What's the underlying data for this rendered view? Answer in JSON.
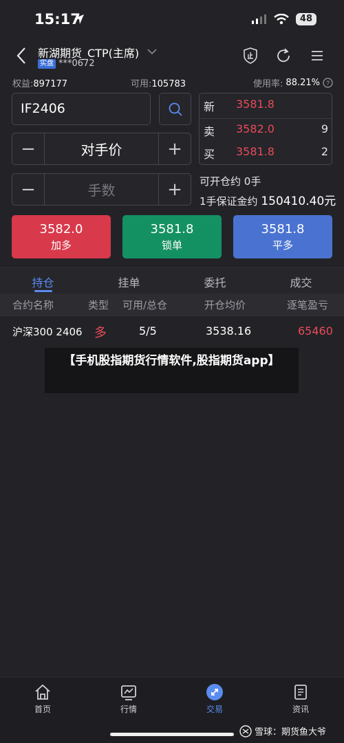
{
  "status_bar": {
    "time": "15:17",
    "battery": "48"
  },
  "header": {
    "account_name": "新湖期货_CTP(主席)",
    "account_tag": "实盘",
    "account_id": "***0672"
  },
  "account_info": {
    "equity_label": "权益:",
    "equity_value": "897177",
    "available_label": "可用:",
    "available_value": "105783",
    "usage_label": "使用率:",
    "usage_value": "88.21%"
  },
  "order_form": {
    "contract": "IF2406",
    "price_mode": "对手价",
    "quantity_placeholder": "手数",
    "minus": "−",
    "plus": "+"
  },
  "quote": {
    "rows": [
      {
        "label": "新",
        "price": "3581.8",
        "volume": ""
      },
      {
        "label": "卖",
        "price": "3582.0",
        "volume": "9"
      },
      {
        "label": "买",
        "price": "3581.8",
        "volume": "2"
      }
    ]
  },
  "position_info": {
    "openable_label": "可开仓约",
    "openable_value": "0手",
    "margin_label": "1手保证金约",
    "margin_value": "150410.40元"
  },
  "actions": [
    {
      "price": "3582.0",
      "label": "加多",
      "color": "#d8394b"
    },
    {
      "price": "3581.8",
      "label": "锁单",
      "color": "#149162"
    },
    {
      "price": "3581.8",
      "label": "平多",
      "color": "#4a73d1"
    }
  ],
  "tabs": [
    "持仓",
    "挂单",
    "委托",
    "成交"
  ],
  "table": {
    "headers": [
      "合约名称",
      "类型",
      "可用/总仓",
      "开仓均价",
      "逐笔盈亏"
    ],
    "rows": [
      {
        "name": "沪深300 2406",
        "type": "多",
        "avail_total": "5/5",
        "avg_price": "3538.16",
        "pnl": "65460"
      }
    ]
  },
  "caption": "【手机股指期货行情软件,股指期货app】",
  "bottom_nav": [
    {
      "label": "首页",
      "icon": "home-icon"
    },
    {
      "label": "行情",
      "icon": "chart-icon"
    },
    {
      "label": "交易",
      "icon": "trade-icon"
    },
    {
      "label": "资讯",
      "icon": "news-icon"
    }
  ],
  "watermark": "雪球：期货鱼大爷",
  "colors": {
    "accent": "#5b8cf0",
    "up": "#e84b5a",
    "background": "#232327"
  }
}
